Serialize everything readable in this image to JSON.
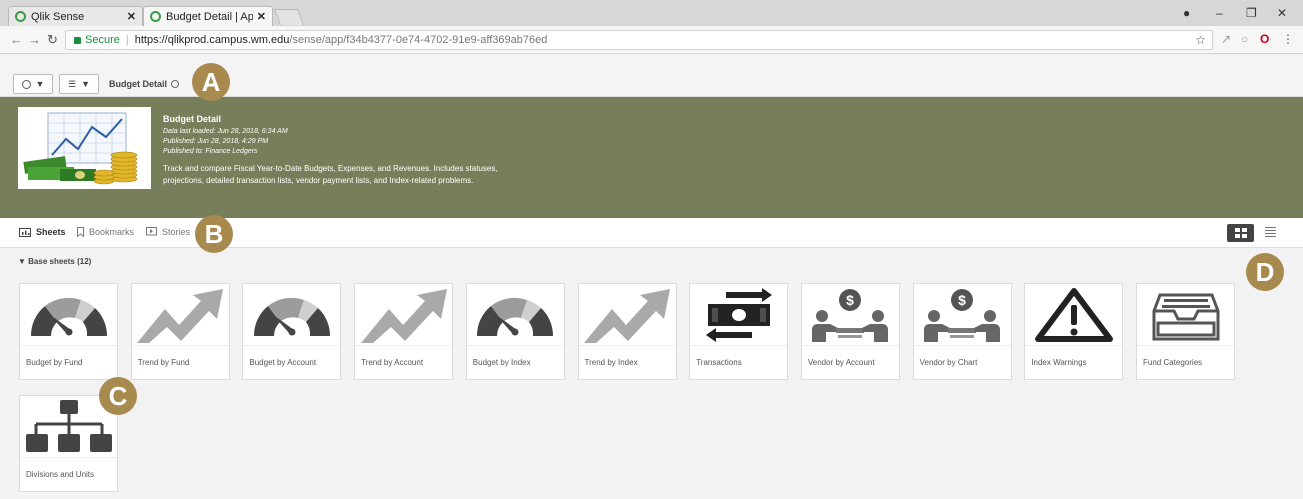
{
  "browser": {
    "tabs": [
      {
        "label": "Qlik Sense",
        "close": "✕"
      },
      {
        "label": "Budget Detail | App overv",
        "close": "✕"
      }
    ],
    "address": {
      "secure_label": "Secure",
      "host": "https://qlikprod.campus.wm.edu",
      "path": "/sense/app/f34b4377-0e74-4702-91e9-aff369ab76ed"
    }
  },
  "toolbar": {
    "app_title": "Budget Detail"
  },
  "app": {
    "title": "Budget Detail",
    "data_loaded": "Data last loaded: Jun 28, 2018, 6:34 AM",
    "published": "Published: Jun 28, 2018, 4:29 PM",
    "published_to": "Published to: Finance Ledgers",
    "description_line1": "Track and compare Fiscal Year-to-Date Budgets, Expenses, and Revenues. Includes statuses,",
    "description_line2": "projections, detailed transaction lists, vendor payment lists, and Index-related problems."
  },
  "nav": {
    "sheets": "Sheets",
    "bookmarks": "Bookmarks",
    "stories": "Stories"
  },
  "section": {
    "label": "Base sheets (12)"
  },
  "sheets": [
    {
      "name": "Budget by Fund",
      "icon": "gauge-icon"
    },
    {
      "name": "Trend by Fund",
      "icon": "trend-icon"
    },
    {
      "name": "Budget by Account",
      "icon": "gauge-icon"
    },
    {
      "name": "Trend by Account",
      "icon": "trend-icon"
    },
    {
      "name": "Budget by Index",
      "icon": "gauge-icon"
    },
    {
      "name": "Trend by Index",
      "icon": "trend-icon"
    },
    {
      "name": "Transactions",
      "icon": "money-exchange-icon"
    },
    {
      "name": "Vendor by Account",
      "icon": "vendor-payment-icon"
    },
    {
      "name": "Vendor by Chart",
      "icon": "vendor-payment-icon"
    },
    {
      "name": "Index Warnings",
      "icon": "warning-icon"
    },
    {
      "name": "Fund Categories",
      "icon": "inbox-tray-icon"
    },
    {
      "name": "Divisions and Units",
      "icon": "org-chart-icon"
    }
  ],
  "callouts": [
    "A",
    "B",
    "C",
    "D"
  ],
  "colors": {
    "banner": "#767f59",
    "callout": "#a88a4f",
    "icon_dark": "#444444",
    "icon_gray": "#9c9c9c",
    "icon_light": "#cfcfcf"
  }
}
